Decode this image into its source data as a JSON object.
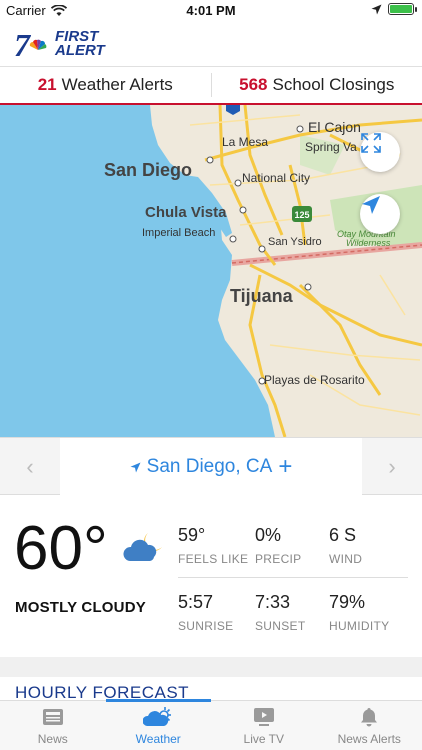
{
  "status_bar": {
    "carrier": "Carrier",
    "time": "4:01 PM"
  },
  "app": {
    "logo_number": "7",
    "logo_text_line1": "FIRST",
    "logo_text_line2": "ALERT"
  },
  "alerts": {
    "weather_count": "21",
    "weather_label": "Weather Alerts",
    "school_count": "568",
    "school_label": "School Closings"
  },
  "map": {
    "labels": {
      "el_cajon": "El Cajon",
      "la_mesa": "La Mesa",
      "spring_valley": "Spring Va",
      "san_diego": "San Diego",
      "national_city": "National City",
      "chula_vista": "Chula Vista",
      "imperial_beach": "Imperial Beach",
      "san_ysidro": "San Ysidro",
      "otay_mountain": "Otay Mountain",
      "wilderness": "Wilderness",
      "tijuana": "Tijuana",
      "playas": "Playas de Rosarito",
      "route_125": "125"
    }
  },
  "location": {
    "name": "San Diego, CA",
    "add": "+",
    "prev": "‹",
    "next": "›"
  },
  "current": {
    "temperature": "60°",
    "condition": "MOSTLY CLOUDY",
    "feels_like_value": "59°",
    "feels_like_label": "FEELS LIKE",
    "precip_value": "0%",
    "precip_label": "PRECIP",
    "wind_value": "6 S",
    "wind_label": "WIND",
    "sunrise_value": "5:57",
    "sunrise_label": "SUNRISE",
    "sunset_value": "7:33",
    "sunset_label": "SUNSET",
    "humidity_value": "79%",
    "humidity_label": "HUMIDITY"
  },
  "hourly": {
    "title": "HOURLY FORECAST"
  },
  "tabs": [
    {
      "label": "News"
    },
    {
      "label": "Weather"
    },
    {
      "label": "Live TV"
    },
    {
      "label": "News Alerts"
    }
  ],
  "colors": {
    "accent": "#2e86de",
    "alert_red": "#c8102e",
    "brand_navy": "#1a3a8c"
  }
}
